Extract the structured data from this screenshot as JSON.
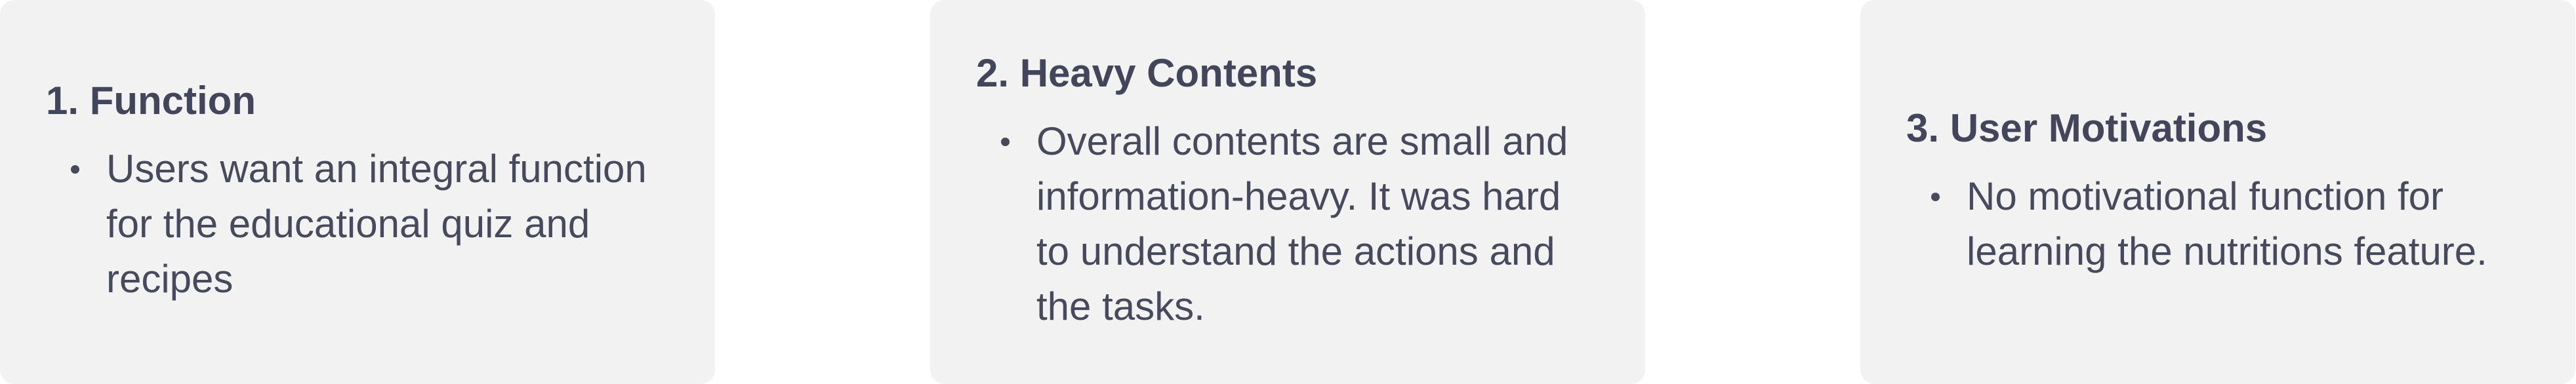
{
  "cards": [
    {
      "title": "1. Function",
      "items": [
        "Users want an integral function for the educational quiz and recipes"
      ]
    },
    {
      "title": "2. Heavy Contents",
      "items": [
        "Overall contents are small and information-heavy. It was hard to understand the actions and the tasks."
      ]
    },
    {
      "title": "3. User Motivations",
      "items": [
        "No motivational function for learning the nutritions feature."
      ]
    }
  ]
}
